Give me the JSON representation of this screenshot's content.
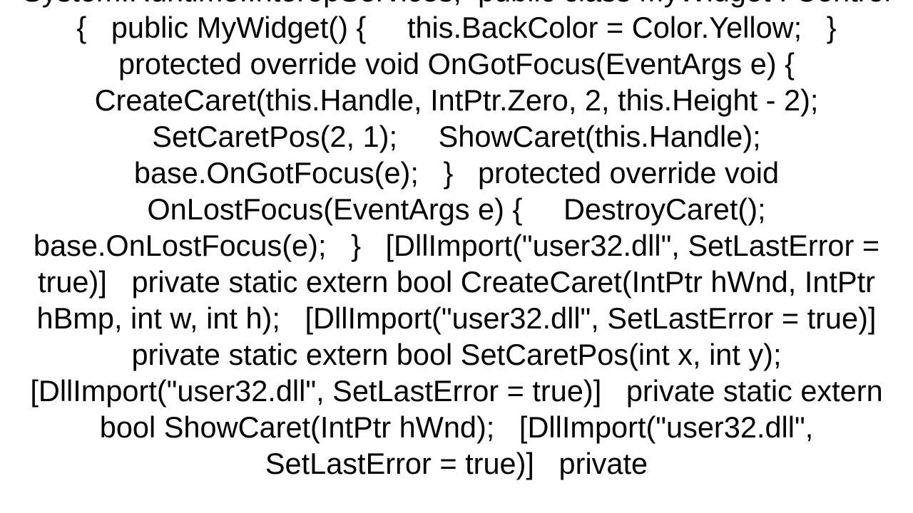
{
  "code": {
    "text": "System.Runtime.InteropServices;  public class MyWidget : Control {   public MyWidget() {     this.BackColor = Color.Yellow;   }   protected override void OnGotFocus(EventArgs e) {     CreateCaret(this.Handle, IntPtr.Zero, 2, this.Height - 2);     SetCaretPos(2, 1);     ShowCaret(this.Handle);     base.OnGotFocus(e);   }   protected override void OnLostFocus(EventArgs e) {     DestroyCaret();     base.OnLostFocus(e);   }   [DllImport(\"user32.dll\", SetLastError = true)]   private static extern bool CreateCaret(IntPtr hWnd, IntPtr hBmp, int w, int h);   [DllImport(\"user32.dll\", SetLastError = true)]   private static extern bool SetCaretPos(int x, int y);   [DllImport(\"user32.dll\", SetLastError = true)]   private static extern bool ShowCaret(IntPtr hWnd);   [DllImport(\"user32.dll\", SetLastError = true)]   private"
  }
}
